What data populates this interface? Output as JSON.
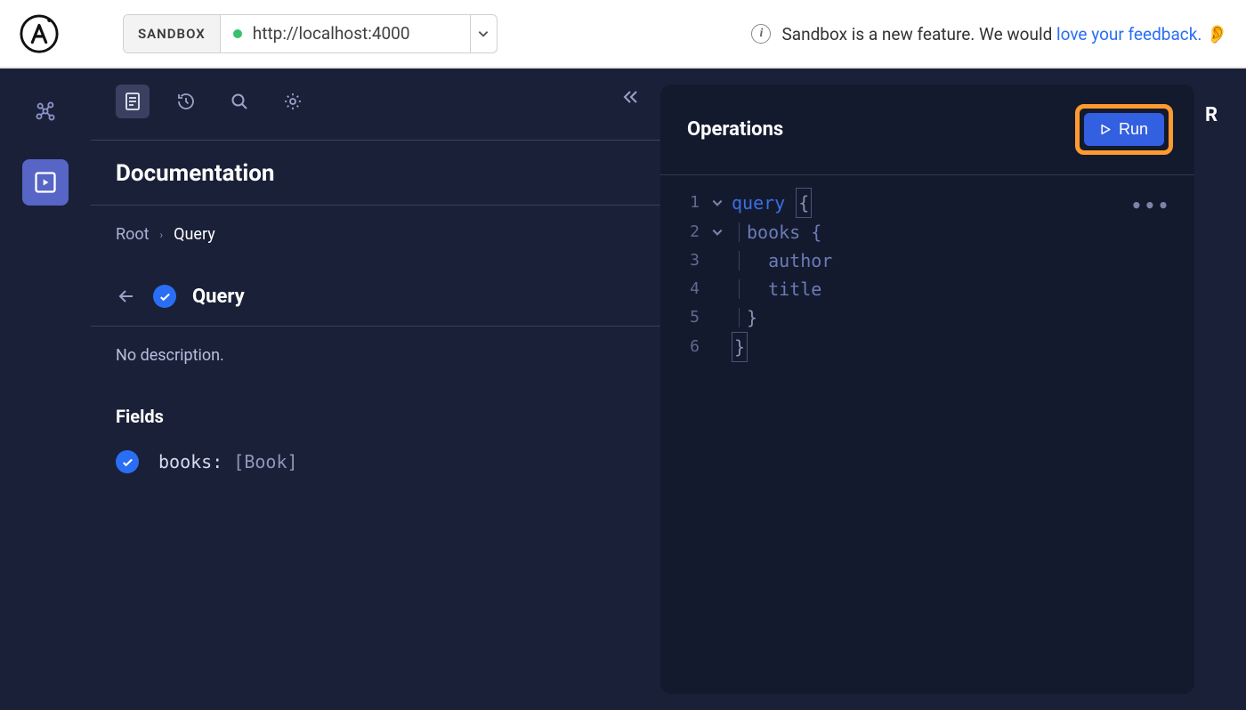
{
  "topbar": {
    "badge": "SANDBOX",
    "url": "http://localhost:4000",
    "banner_prefix": "Sandbox is a new feature. We would ",
    "banner_link": "love your feedback.",
    "ear_emoji": "👂"
  },
  "doc": {
    "title": "Documentation",
    "breadcrumb": {
      "root": "Root",
      "current": "Query"
    },
    "type_name": "Query",
    "no_description": "No description.",
    "fields_heading": "Fields",
    "field": {
      "name": "books:",
      "type": "[Book]"
    }
  },
  "ops": {
    "title": "Operations",
    "run_label": "Run",
    "lines": {
      "l1_kw": "query",
      "l2_field": "books {",
      "l3_field": "author",
      "l4_field": "title",
      "l5_close": "}",
      "l6_close": "}"
    }
  },
  "response": {
    "title_partial": "R"
  }
}
